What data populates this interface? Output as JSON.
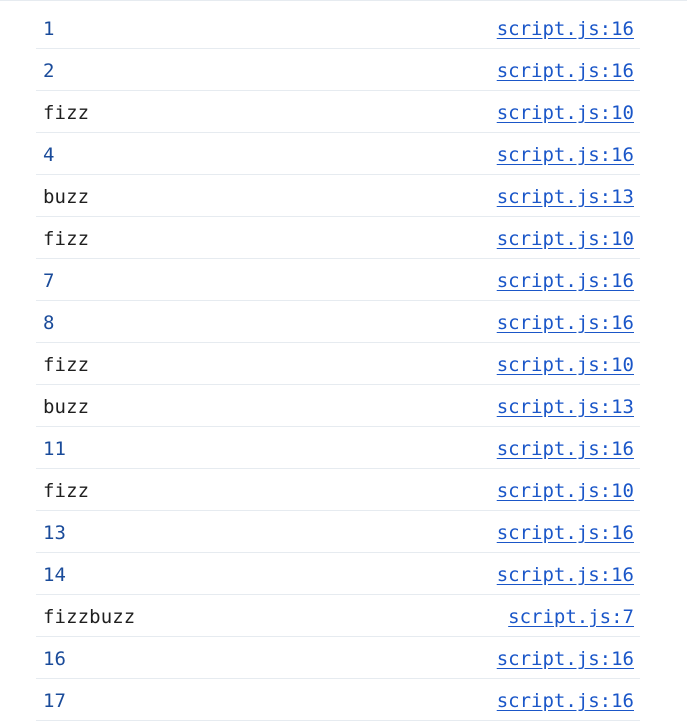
{
  "console": {
    "entries": [
      {
        "message": "1",
        "kind": "number",
        "source": "script.js:16"
      },
      {
        "message": "2",
        "kind": "number",
        "source": "script.js:16"
      },
      {
        "message": "fizz",
        "kind": "text",
        "source": "script.js:10"
      },
      {
        "message": "4",
        "kind": "number",
        "source": "script.js:16"
      },
      {
        "message": "buzz",
        "kind": "text",
        "source": "script.js:13"
      },
      {
        "message": "fizz",
        "kind": "text",
        "source": "script.js:10"
      },
      {
        "message": "7",
        "kind": "number",
        "source": "script.js:16"
      },
      {
        "message": "8",
        "kind": "number",
        "source": "script.js:16"
      },
      {
        "message": "fizz",
        "kind": "text",
        "source": "script.js:10"
      },
      {
        "message": "buzz",
        "kind": "text",
        "source": "script.js:13"
      },
      {
        "message": "11",
        "kind": "number",
        "source": "script.js:16"
      },
      {
        "message": "fizz",
        "kind": "text",
        "source": "script.js:10"
      },
      {
        "message": "13",
        "kind": "number",
        "source": "script.js:16"
      },
      {
        "message": "14",
        "kind": "number",
        "source": "script.js:16"
      },
      {
        "message": "fizzbuzz",
        "kind": "text",
        "source": "script.js:7"
      },
      {
        "message": "16",
        "kind": "number",
        "source": "script.js:16"
      },
      {
        "message": "17",
        "kind": "number",
        "source": "script.js:16"
      }
    ]
  },
  "colors": {
    "number": "#1a4b9a",
    "text": "#1f1f1f",
    "link": "#1a56c8",
    "divider": "#e6ebf0"
  }
}
